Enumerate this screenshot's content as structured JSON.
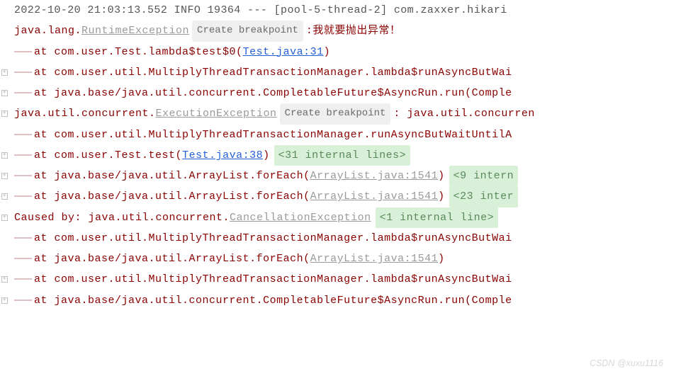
{
  "header": "2022-10-20 21:03:13.552  INFO 19364 --- [pool-5-thread-2] com.zaxxer.hikari",
  "breakpoint_label": "Create breakpoint",
  "exc1_prefix": "java.lang.",
  "exc1_name": "RuntimeException",
  "exc1_msg": "我就要抛出异常！",
  "exc2_prefix": "java.util.concurrent.",
  "exc2_name": "ExecutionException",
  "exc2_suffix": ": java.util.concurren",
  "caused_prefix": "Caused by: java.util.concurrent.",
  "caused_name": "CancellationException",
  "lines": {
    "l3": {
      "pkg": "at com.user.Test.lambda$test$0(",
      "link": "Test.java:31",
      "close": ")"
    },
    "l4": "at com.user.util.MultiplyThreadTransactionManager.lambda$runAsyncButWai",
    "l5": "at java.base/java.util.concurrent.CompletableFuture$AsyncRun.run(Comple",
    "l7": "at com.user.util.MultiplyThreadTransactionManager.runAsyncButWaitUntilA",
    "l8": {
      "pkg": "at com.user.Test.test(",
      "link": "Test.java:38",
      "close": ")",
      "fold": "<31 internal lines>"
    },
    "l9": {
      "pkg": "at java.base/java.util.ArrayList.forEach(",
      "glink": "ArrayList.java:1541",
      "close": ")",
      "fold": "<9 intern"
    },
    "l10": {
      "pkg": "at java.base/java.util.ArrayList.forEach(",
      "glink": "ArrayList.java:1541",
      "close": ")",
      "fold": "<23 inter"
    },
    "l11_fold": "<1 internal line>",
    "l12": "at com.user.util.MultiplyThreadTransactionManager.lambda$runAsyncButWai",
    "l13": {
      "pkg": "at java.base/java.util.ArrayList.forEach(",
      "glink": "ArrayList.java:1541",
      "close": ")"
    },
    "l14": "at com.user.util.MultiplyThreadTransactionManager.lambda$runAsyncButWai",
    "l15": "at java.base/java.util.concurrent.CompletableFuture$AsyncRun.run(Comple"
  },
  "dash": "———",
  "colon": " : ",
  "watermark": "CSDN @xuxu1116"
}
